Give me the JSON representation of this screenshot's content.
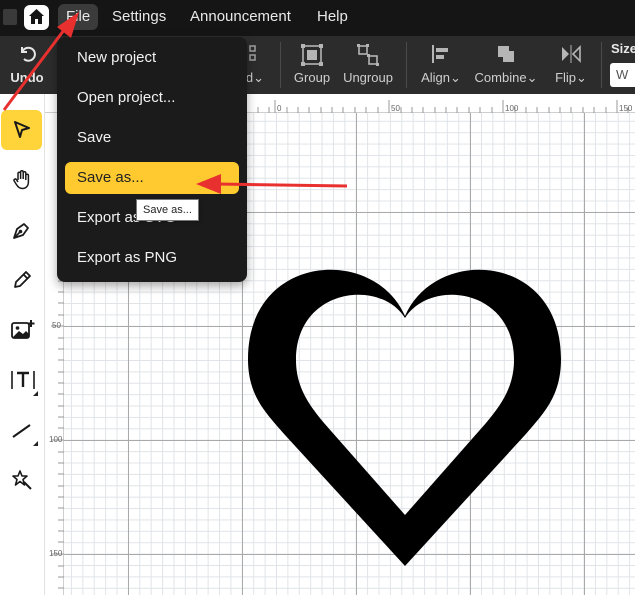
{
  "menubar": {
    "items": [
      {
        "label": "File"
      },
      {
        "label": "Settings"
      },
      {
        "label": "Announcement"
      },
      {
        "label": "Help"
      }
    ]
  },
  "toolbar": {
    "undo": "Undo",
    "partial_label": "d",
    "group": "Group",
    "ungroup": "Ungroup",
    "align": "Align",
    "combine": "Combine",
    "flip": "Flip",
    "size_label": "Size",
    "width_field": "W"
  },
  "left_tools": [
    {
      "name": "select-tool-icon"
    },
    {
      "name": "hand-tool-icon"
    },
    {
      "name": "pen-tool-icon"
    },
    {
      "name": "pencil-tool-icon"
    },
    {
      "name": "image-tool-icon"
    },
    {
      "name": "text-tool-icon"
    },
    {
      "name": "line-tool-icon"
    },
    {
      "name": "magic-tool-icon"
    }
  ],
  "ruler": {
    "top_labels": [
      "0",
      "50",
      "100",
      "150"
    ],
    "left_labels": [
      "50",
      "100",
      "150"
    ]
  },
  "file_menu": {
    "items": [
      {
        "label": "New project"
      },
      {
        "label": "Open project..."
      },
      {
        "label": "Save"
      },
      {
        "label": "Save as..."
      },
      {
        "label": "Export as SVG"
      },
      {
        "label": "Export as PNG"
      }
    ],
    "highlighted_index": 3,
    "tooltip": "Save as..."
  },
  "colors": {
    "accent": "#ffc930",
    "annotation_arrow": "#e8302f",
    "menubar_bg": "#151515",
    "toolbar_bg": "#2c2c2c"
  }
}
